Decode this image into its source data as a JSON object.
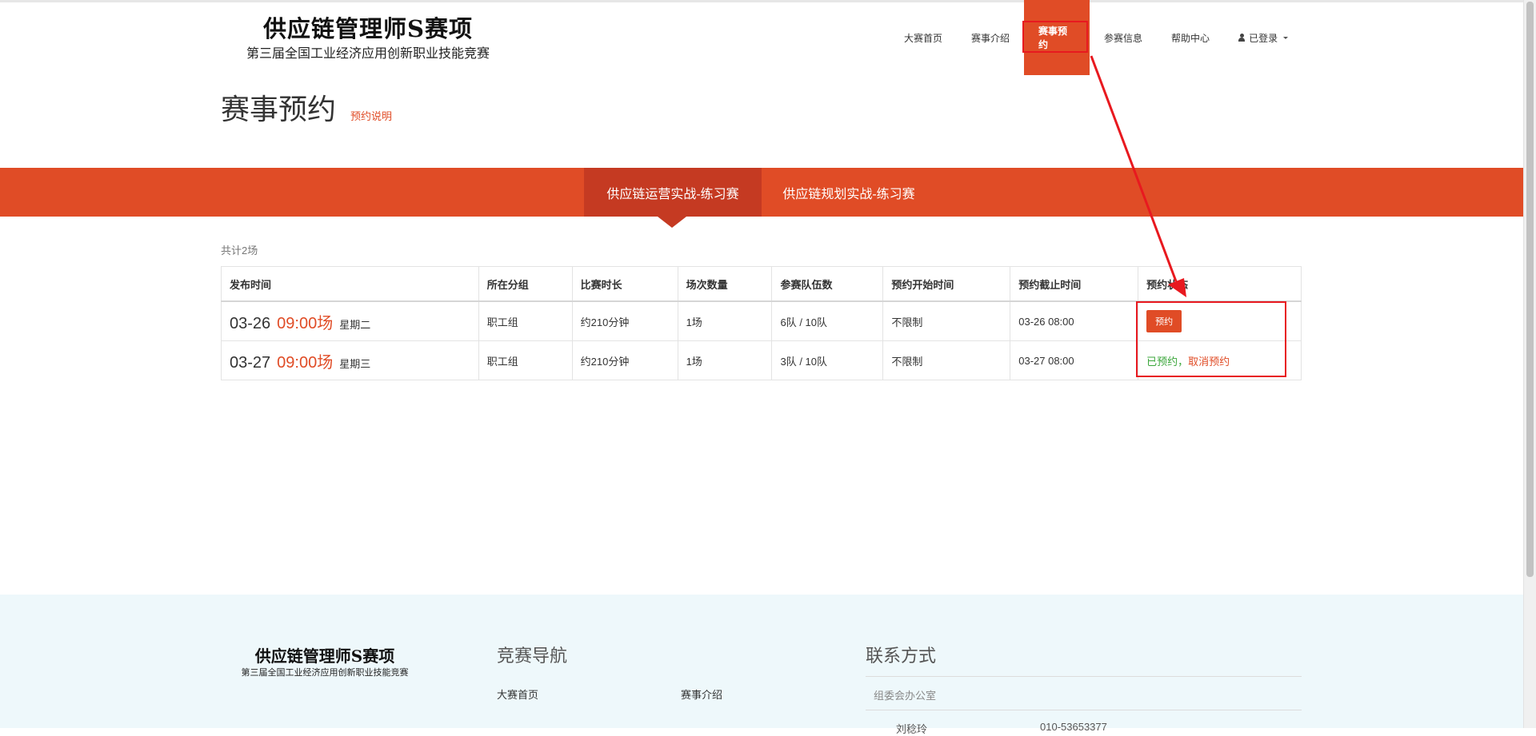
{
  "brand": {
    "title": "供应链管理师S赛项",
    "subtitle": "第三届全国工业经济应用创新职业技能竞赛"
  },
  "nav": {
    "items": [
      "大赛首页",
      "赛事介绍",
      "赛事预约",
      "参赛信息",
      "帮助中心"
    ],
    "active": "赛事预约",
    "user_label": "已登录"
  },
  "page": {
    "title": "赛事预约",
    "help_link": "预约说明"
  },
  "tabs": [
    "供应链运营实战-练习赛",
    "供应链规划实战-练习赛"
  ],
  "summary": "共计2场",
  "table": {
    "headers": [
      "发布时间",
      "所在分组",
      "比赛时长",
      "场次数量",
      "参赛队伍数",
      "预约开始时间",
      "预约截止时间",
      "预约状态"
    ],
    "rows": [
      {
        "date": "03-26",
        "time": "09:00场",
        "weekday": "星期二",
        "group": "职工组",
        "duration": "约210分钟",
        "sessions": "1场",
        "teams": "6队 / 10队",
        "start": "不限制",
        "deadline": "03-26 08:00",
        "action": "预约"
      },
      {
        "date": "03-27",
        "time": "09:00场",
        "weekday": "星期三",
        "group": "职工组",
        "duration": "约210分钟",
        "sessions": "1场",
        "teams": "3队 / 10队",
        "start": "不限制",
        "deadline": "03-27 08:00",
        "status": "已预约",
        "separator": "，",
        "cancel": "取消预约"
      }
    ]
  },
  "footer": {
    "brand_title": "供应链管理师S赛项",
    "brand_subtitle": "第三届全国工业经济应用创新职业技能竞赛",
    "nav_heading": "竞赛导航",
    "nav_links": [
      "大赛首页",
      "赛事介绍"
    ],
    "contact_heading": "联系方式",
    "contact_office": "组委会办公室",
    "contact_name": "刘稔玲",
    "contact_phone": "010-53653377"
  },
  "colors": {
    "accent": "#e04c26",
    "accent_dark": "#c53a22",
    "annotation": "#e8191f",
    "booked": "#3aa63a",
    "footer_bg": "#eef8fb"
  }
}
